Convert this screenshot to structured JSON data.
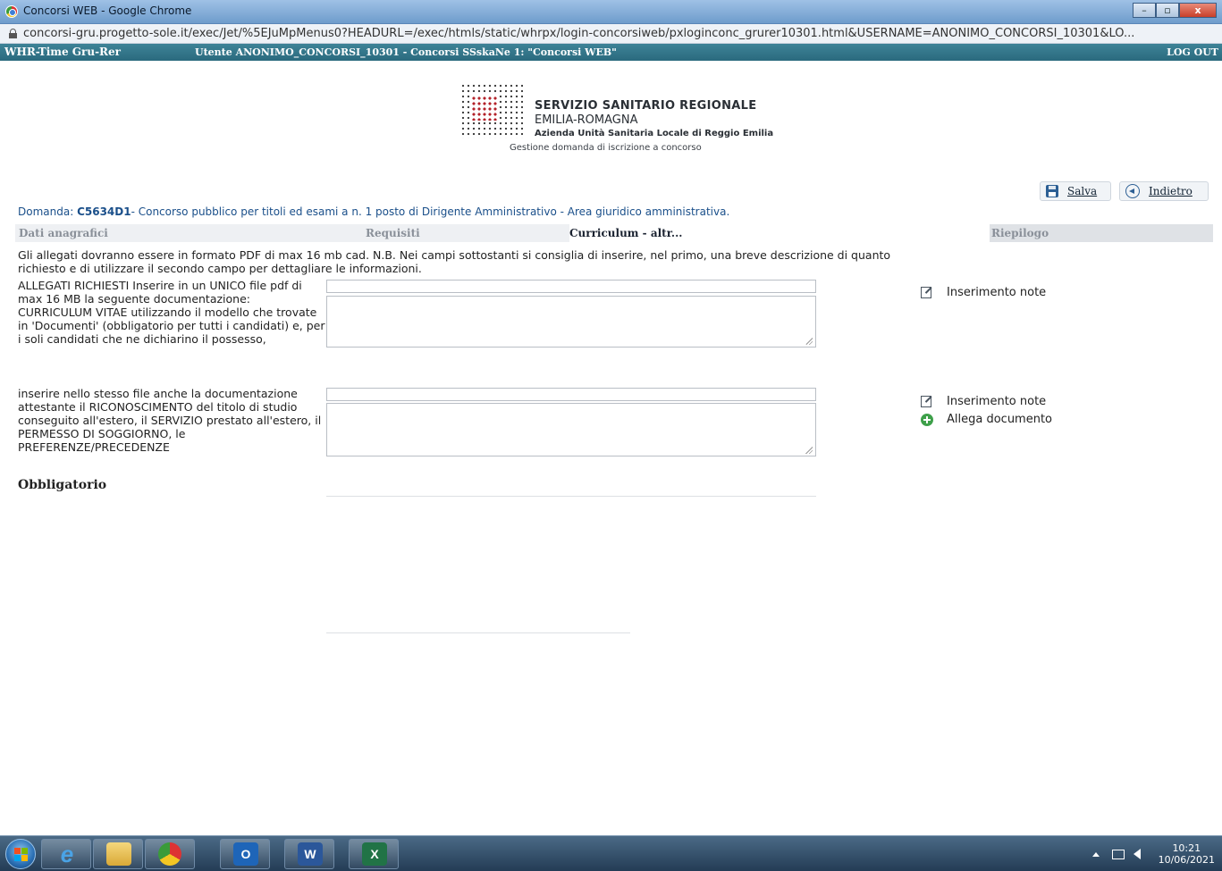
{
  "window": {
    "title": "Concorsi WEB - Google Chrome",
    "url": "concorsi-gru.progetto-sole.it/exec/Jet/%5EJuMpMenus0?HEADURL=/exec/htmls/static/whrpx/login-concorsiweb/pxloginconc_grurer10301.html&USERNAME=ANONIMO_CONCORSI_10301&LO...",
    "controls": {
      "minimize": "–",
      "maximize": "▫",
      "close": "x"
    }
  },
  "header": {
    "app_name": "WHR-Time Gru-Rer",
    "user_info": "Utente ANONIMO_CONCORSI_10301 - Concorsi SSskaNe 1: \"Concorsi WEB\"",
    "logout": "LOG OUT"
  },
  "logo": {
    "line1": "SERVIZIO SANITARIO REGIONALE",
    "line2": "EMILIA-ROMAGNA",
    "line3": "Azienda Unità Sanitaria Locale di Reggio Emilia",
    "subtitle": "Gestione domanda di iscrizione a concorso"
  },
  "actions": {
    "save": "Salva",
    "back": "Indietro"
  },
  "domanda": {
    "prefix": "Domanda: ",
    "code": "C5634D1",
    "text": "- Concorso pubblico per titoli ed esami a n. 1 posto di Dirigente Amministrativo - Area giuridico amministrativa."
  },
  "tabs": [
    {
      "label": "Dati anagrafici"
    },
    {
      "label": "Requisiti"
    },
    {
      "label": "Curriculum - altr..."
    },
    {
      "label": "Riepilogo"
    }
  ],
  "content": {
    "instructions": "Gli allegati dovranno essere in formato PDF di max 16 mb cad. N.B. Nei campi sottostanti si consiglia di inserire, nel primo, una breve descrizione di quanto richiesto e di utilizzare il secondo campo per dettagliare le informazioni.",
    "label1": "ALLEGATI RICHIESTI Inserire in un UNICO file pdf di max 16 MB la seguente documentazione: CURRICULUM VITAE utilizzando il modello che trovate in 'Documenti' (obbligatorio per tutti i candidati) e, per i soli candidati che ne dichiarino il possesso,",
    "label2": "inserire nello stesso file anche la documentazione attestante il RICONOSCIMENTO del titolo di studio conseguito all'estero, il SERVIZIO prestato all'estero, il PERMESSO DI SOGGIORNO, le PREFERENZE/PRECEDENZE",
    "obbligatorio": "Obbligatorio",
    "field1": {
      "short_value": "",
      "long_value": ""
    },
    "field2": {
      "short_value": "",
      "long_value": ""
    },
    "note_link": "Inserimento note",
    "attach_link": "Allega documento"
  },
  "taskbar": {
    "time": "10:21",
    "date": "10/06/2021",
    "apps": [
      "internet-explorer",
      "file-explorer",
      "chrome",
      "outlook",
      "word",
      "excel"
    ]
  }
}
